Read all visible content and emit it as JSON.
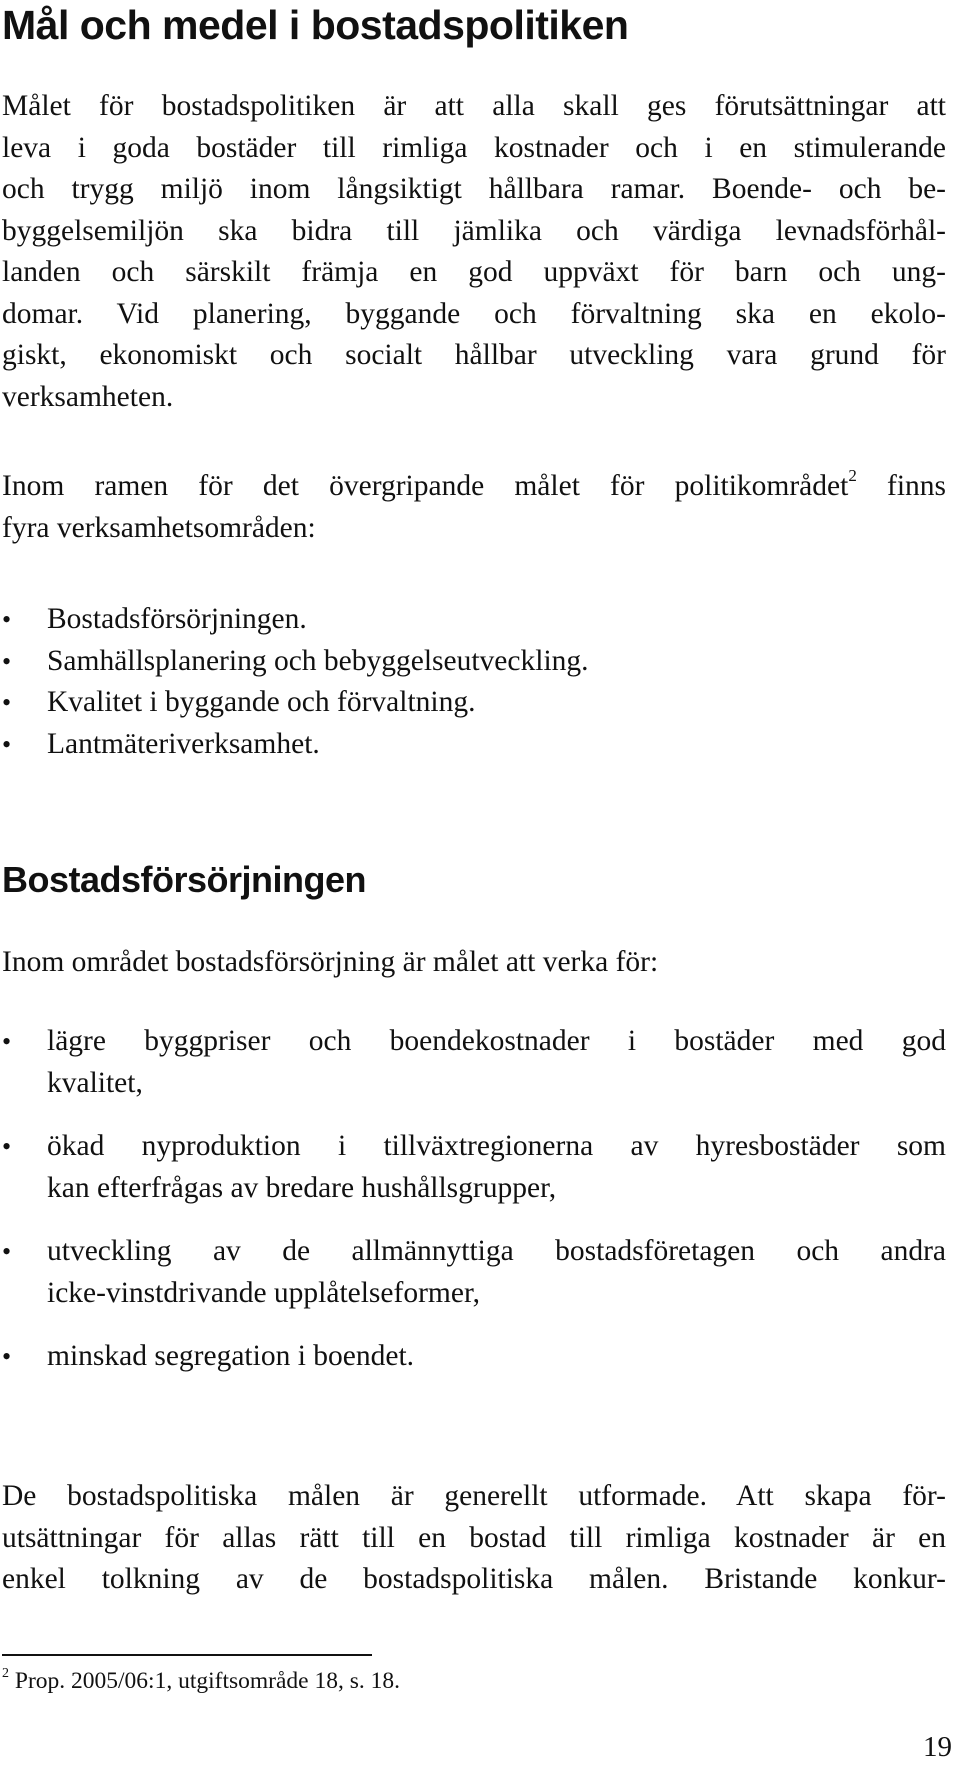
{
  "heading_main": "Mål och medel i bostadspolitiken",
  "intro_paragraph_lines": [
    "Målet för bostadspolitiken är att alla skall ges förutsättningar att",
    "leva i goda bostäder till rimliga kostnader och i en stimulerande",
    "och trygg miljö inom långsiktigt hållbara ramar. Boende- och be-",
    "byggelsemiljön ska bidra till jämlika och värdiga levnadsförhål-",
    "landen och särskilt främja en god uppväxt för barn och ung-",
    "domar. Vid planering, byggande och förvaltning ska en ekolo-",
    "giskt, ekonomiskt och socialt hållbar utveckling vara grund för",
    "verksamheten."
  ],
  "areas_intro": {
    "line1_before_ref": "Inom ramen för det övergripande målet för politikområdet",
    "footnote_ref": "2",
    "line1_after_ref": " finns",
    "line2": "fyra verksamhetsområden:"
  },
  "areas_list": [
    "Bostadsförsörjningen.",
    "Samhällsplanering och bebyggelseutveckling.",
    "Kvalitet i byggande och förvaltning.",
    "Lantmäteriverksamhet."
  ],
  "bullet_glyph": "•",
  "heading_section": "Bostadsförsörjningen",
  "section_intro": "Inom området bostadsförsörjning är målet att verka för:",
  "goals_list": [
    {
      "lines": [
        "lägre byggpriser och boendekostnader i bostäder med god",
        "kvalitet,"
      ]
    },
    {
      "lines": [
        "ökad nyproduktion i tillväxtregionerna av hyresbostäder som",
        "kan efterfrågas av bredare hushållsgrupper,"
      ]
    },
    {
      "lines": [
        "utveckling av de allmännyttiga bostadsföretagen och andra",
        "icke-vinstdrivande upplåtelseformer,"
      ]
    },
    {
      "lines": [
        "minskad segregation i boendet."
      ]
    }
  ],
  "closing_paragraph_lines": [
    "De bostadspolitiska målen är generellt utformade. Att skapa för-",
    "utsättningar för allas rätt till en bostad till rimliga kostnader är en",
    "enkel tolkning av de bostadspolitiska målen. Bristande konkur-"
  ],
  "footnote": {
    "number": "2",
    "text": " Prop. 2005/06:1, utgiftsområde 18, s. 18."
  },
  "page_number": "19"
}
